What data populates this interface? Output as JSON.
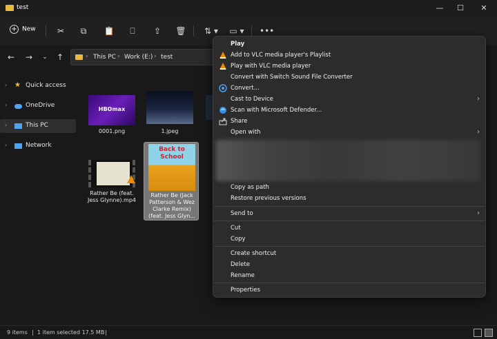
{
  "window": {
    "title": "test"
  },
  "toolbar": {
    "new_label": "New"
  },
  "address": {
    "crumbs": [
      "This PC",
      "Work (E:)",
      "test"
    ]
  },
  "sidebar": {
    "items": [
      {
        "label": "Quick access",
        "icon": "star-icon"
      },
      {
        "label": "OneDrive",
        "icon": "cloud-icon"
      },
      {
        "label": "This PC",
        "icon": "monitor-icon"
      },
      {
        "label": "Network",
        "icon": "network-icon"
      }
    ]
  },
  "files": [
    {
      "name": "0001.png",
      "thumb_text": "HBOmax"
    },
    {
      "name": "1.jpeg"
    },
    {
      "name": "Rather Be (feat. Jess Glynne).mp4"
    },
    {
      "name": "Rather Be (Jack Patterson & Wez Clarke Remix) (feat. Jess Glyn...",
      "thumb_text": "Back to School",
      "selected": true
    }
  ],
  "context_menu": {
    "items": [
      {
        "label": "Play",
        "bold": true
      },
      {
        "label": "Add to VLC media player's Playlist",
        "icon": "vlc-icon"
      },
      {
        "label": "Play with VLC media player",
        "icon": "vlc-icon"
      },
      {
        "label": "Convert with Switch Sound File Converter"
      },
      {
        "label": "Convert...",
        "icon": "convert-icon"
      },
      {
        "label": "Cast to Device",
        "submenu": true
      },
      {
        "label": "Scan with Microsoft Defender...",
        "icon": "defender-icon"
      },
      {
        "label": "Share",
        "icon": "share-icon"
      },
      {
        "label": "Open with",
        "submenu": true
      },
      {
        "label": "Copy as path"
      },
      {
        "label": "Restore previous versions"
      },
      {
        "label": "Send to",
        "submenu": true
      },
      {
        "label": "Cut"
      },
      {
        "label": "Copy"
      },
      {
        "label": "Create shortcut"
      },
      {
        "label": "Delete"
      },
      {
        "label": "Rename"
      },
      {
        "label": "Properties"
      }
    ]
  },
  "status": {
    "items_count": "9 items",
    "selection": "1 item selected  17.5 MB"
  },
  "colors": {
    "accent": "#4ea1f3",
    "folder": "#e8b93a",
    "vlc": "#f08a00"
  }
}
